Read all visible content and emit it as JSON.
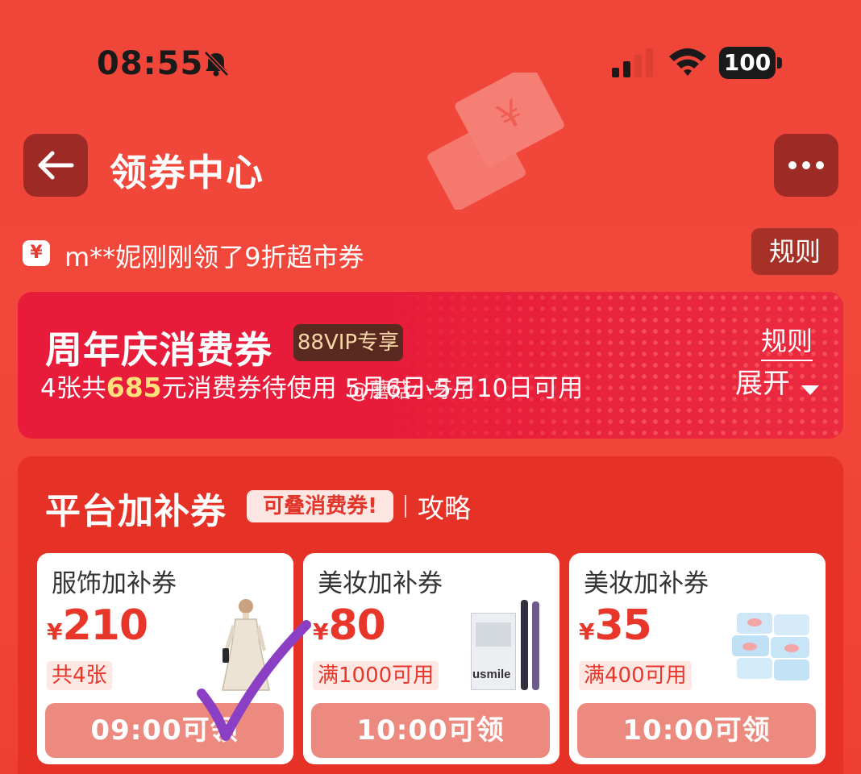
{
  "status_bar": {
    "time": "08:55",
    "battery": "100"
  },
  "nav": {
    "title": "领券中心"
  },
  "ticker": {
    "icon": "¥",
    "text": "m**妮刚刚领了9折超市券",
    "rules": "规则"
  },
  "anniversary": {
    "title": "周年庆消费券",
    "badge": "88VIP专享",
    "subtitle_prefix": "4张共",
    "subtitle_amount": "685",
    "subtitle_suffix": "元消费券待使用 5月6日-5月10日可用",
    "rules": "规则",
    "expand": "展开",
    "watermark": "@蘑菇小牙子"
  },
  "platform": {
    "title": "平台加补券",
    "tag": "可叠消费券!",
    "guide": "攻略",
    "coupons": [
      {
        "name": "服饰加补券",
        "currency": "¥",
        "value": "210",
        "condition": "共4张",
        "claim": "09:00可领",
        "image": "dress-model"
      },
      {
        "name": "美妆加补券",
        "currency": "¥",
        "value": "80",
        "condition": "满1000可用",
        "claim": "10:00可领",
        "image": "usmile-toothbrush"
      },
      {
        "name": "美妆加补券",
        "currency": "¥",
        "value": "35",
        "condition": "满400可用",
        "claim": "10:00可领",
        "image": "tissue-packs"
      }
    ]
  },
  "product_labels": {
    "toothbrush_brand": "usmile"
  },
  "colors": {
    "accent": "#e8362b",
    "background": "#f0463a",
    "button_dark": "#9e2a26",
    "vip_badge": "#5a2a20",
    "checkmark": "#8b3fc4"
  },
  "annotation": {
    "icon": "checkmark-icon"
  }
}
